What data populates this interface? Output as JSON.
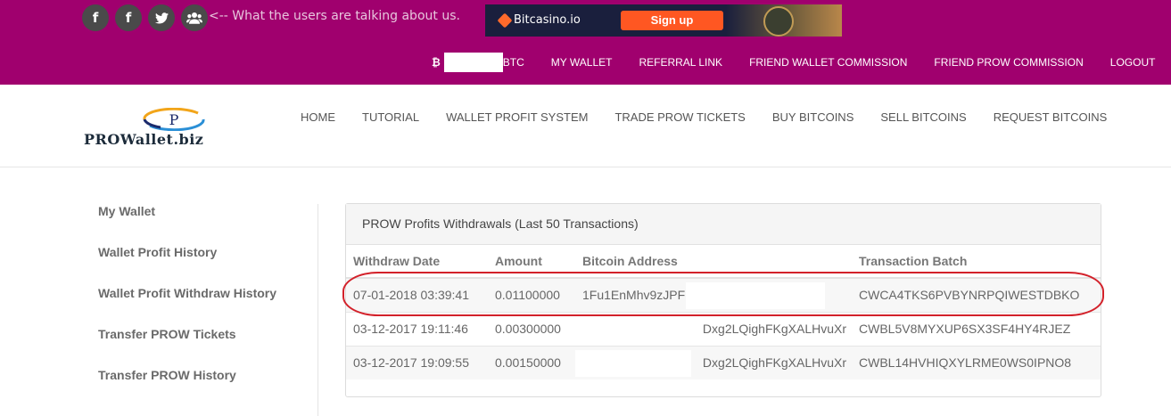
{
  "social": {
    "buttons": [
      {
        "icon": "facebook-icon",
        "glyph": "f"
      },
      {
        "icon": "facebook-icon",
        "glyph": "f"
      },
      {
        "icon": "twitter-icon",
        "glyph": ""
      },
      {
        "icon": "users-icon",
        "glyph": ""
      }
    ],
    "note": "<-- What the users are talking about us."
  },
  "ad": {
    "brand": "Bitcasino.io",
    "cta": "Sign up"
  },
  "account_nav": {
    "btc_symbol": "₿",
    "btc_label": "BTC",
    "links": [
      "MY WALLET",
      "REFERRAL LINK",
      "FRIEND WALLET COMMISSION",
      "FRIEND PROW COMMISSION",
      "LOGOUT"
    ]
  },
  "logo": {
    "mark_letter": "P",
    "text": "PROWallet.biz"
  },
  "main_nav": [
    "HOME",
    "TUTORIAL",
    "WALLET PROFIT SYSTEM",
    "TRADE PROW TICKETS",
    "BUY BITCOINS",
    "SELL BITCOINS",
    "REQUEST BITCOINS"
  ],
  "sidebar": [
    "My Wallet",
    "Wallet Profit History",
    "Wallet Profit Withdraw History",
    "Transfer PROW Tickets",
    "Transfer PROW History"
  ],
  "panel": {
    "title": "PROW Profits Withdrawals (Last 50 Transactions)",
    "columns": [
      "Withdraw Date",
      "Amount",
      "Bitcoin Address",
      "Transaction Batch"
    ],
    "rows": [
      {
        "date": "07-01-2018 03:39:41",
        "amount": "0.01100000",
        "address": "1Fu1EnMhv9zJPF",
        "batch": "CWCA4TKS6PVBYNRPQIWESTDBKO"
      },
      {
        "date": "03-12-2017 19:11:46",
        "amount": "0.00300000",
        "address": "Dxg2LQighFKgXALHvuXr",
        "batch": "CWBL5V8MYXUP6SX3SF4HY4RJEZ"
      },
      {
        "date": "03-12-2017 19:09:55",
        "amount": "0.00150000",
        "address": "Dxg2LQighFKgXALHvuXr",
        "batch": "CWBL14HVHIQXYLRME0WS0IPNO8"
      }
    ]
  },
  "colors": {
    "topbar": "#a0006e",
    "highlight": "#d3212a"
  }
}
